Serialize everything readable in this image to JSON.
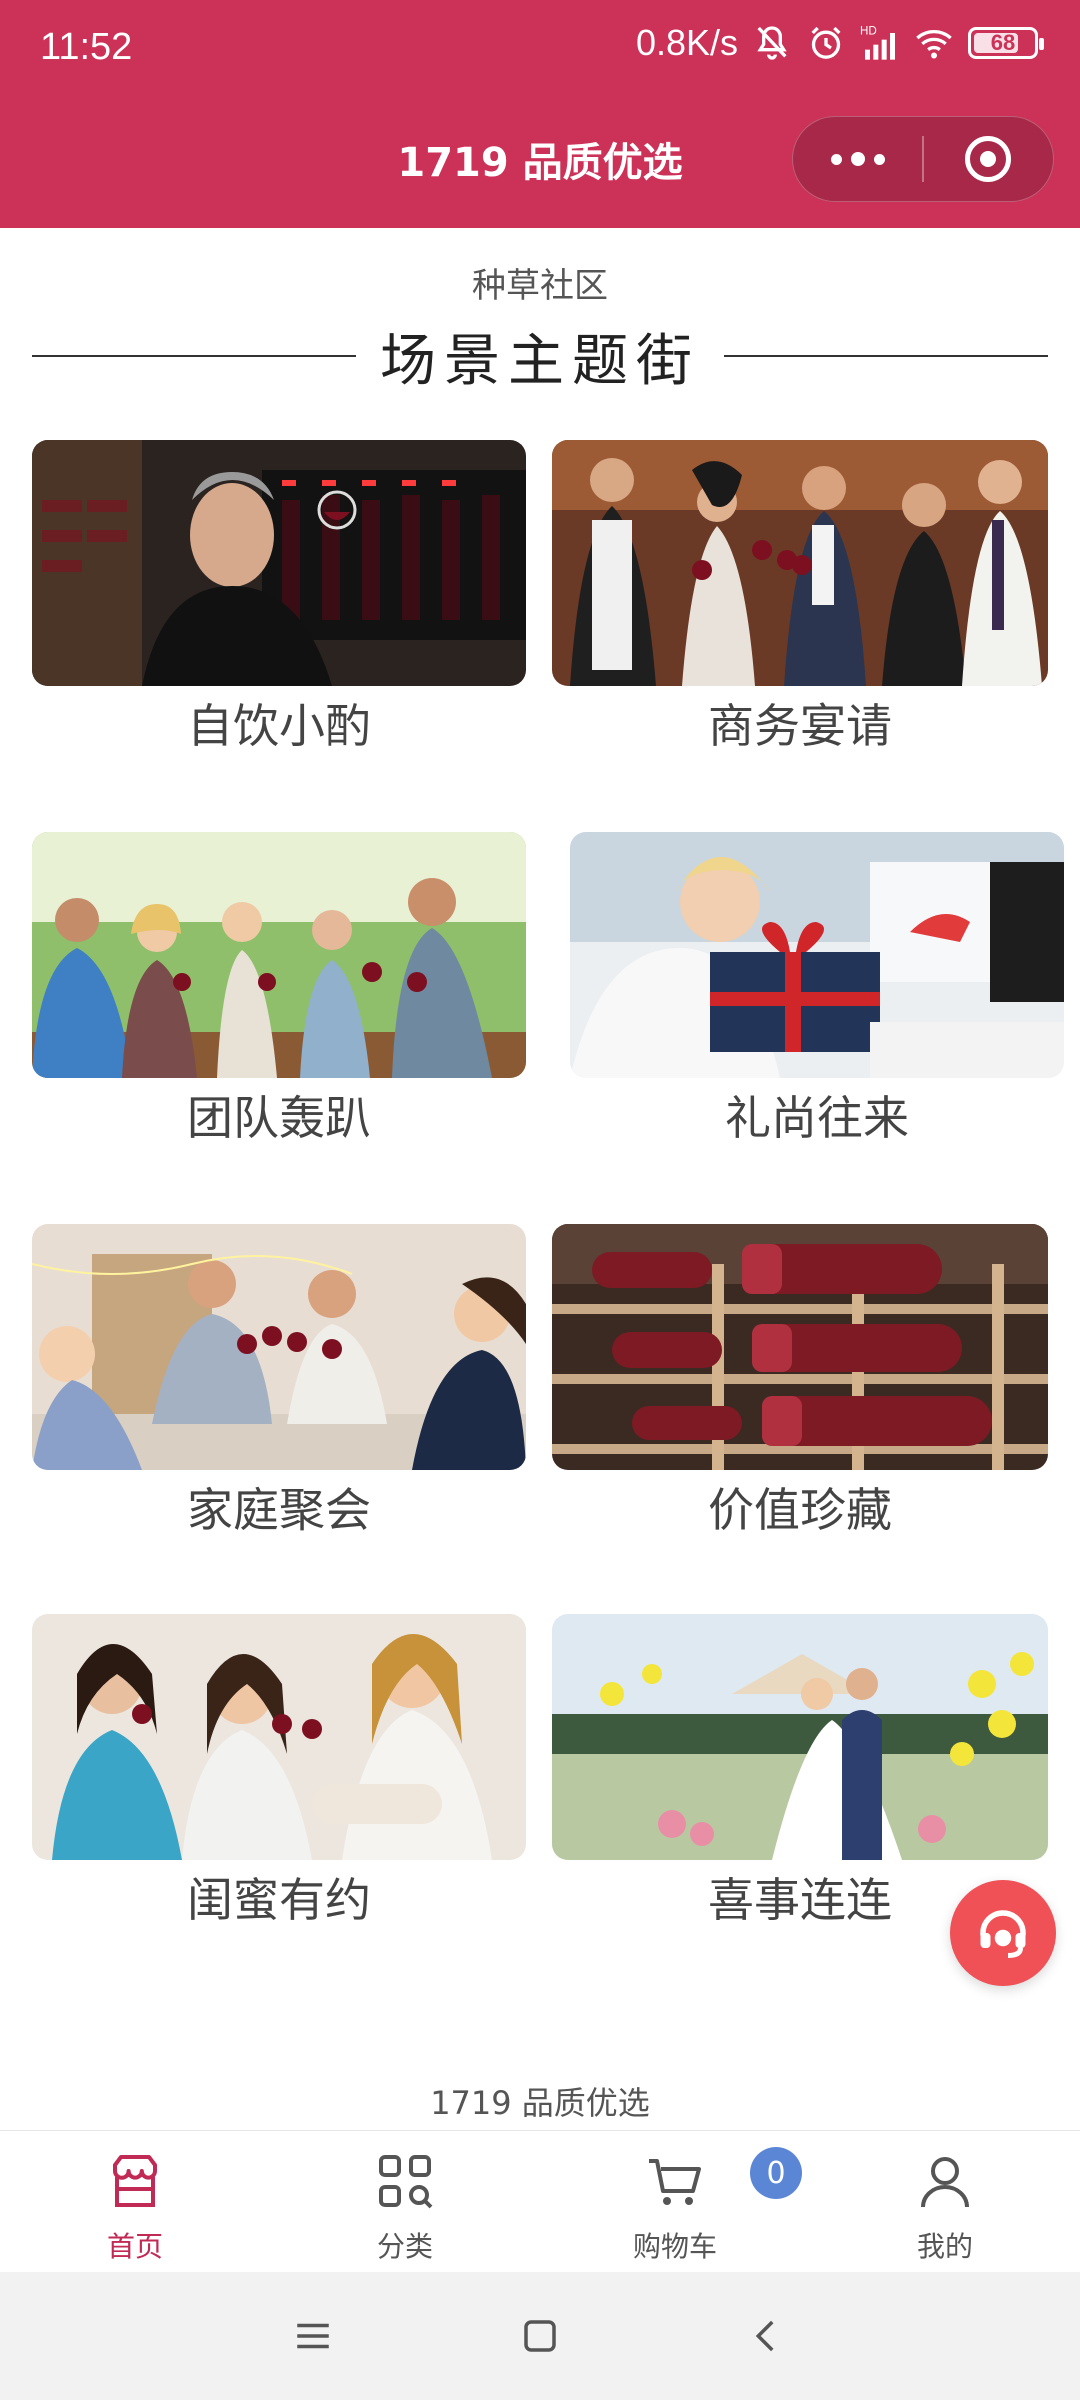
{
  "status_bar": {
    "time": "11:52",
    "net_speed": "0.8K/s",
    "battery": "68",
    "battery_level": 0.68,
    "icons": [
      "mute-bell-icon",
      "alarm-clock-icon",
      "hd-signal-icon",
      "wifi-icon",
      "battery-icon"
    ]
  },
  "nav": {
    "title": "1719 品质优选",
    "more_icon": "more-dots-icon",
    "close_icon": "target-close-icon"
  },
  "section": {
    "subtitle": "种草社区",
    "title": "场景主题街"
  },
  "scenes": [
    {
      "label": "自饮小酌",
      "image": "man-tasting-red-wine-at-wine-cabinet"
    },
    {
      "label": "商务宴请",
      "image": "business-people-toasting-wine"
    },
    {
      "label": "团队轰趴",
      "image": "friends-party-outdoors-with-wine"
    },
    {
      "label": "礼尚往来",
      "image": "woman-giving-gift-box"
    },
    {
      "label": "家庭聚会",
      "image": "family-toasting-at-dinner-table"
    },
    {
      "label": "价值珍藏",
      "image": "wine-bottles-in-rack"
    },
    {
      "label": "闺蜜有约",
      "image": "women-friends-drinking-wine"
    },
    {
      "label": "喜事连连",
      "image": "wedding-couple-outdoor-ceremony"
    }
  ],
  "footer_brand": "1719 品质优选",
  "tabbar": {
    "tabs": [
      {
        "label": "首页",
        "icon": "shop-icon",
        "active": true
      },
      {
        "label": "分类",
        "icon": "category-grid-icon",
        "active": false
      },
      {
        "label": "购物车",
        "icon": "cart-icon",
        "active": false
      },
      {
        "label": "我的",
        "icon": "user-icon",
        "active": false
      }
    ],
    "cart_count": "0"
  },
  "colors": {
    "brand": "#cc3158",
    "tab_active": "#c02a55",
    "fab": "#ef5156",
    "badge": "#5b86d6"
  }
}
